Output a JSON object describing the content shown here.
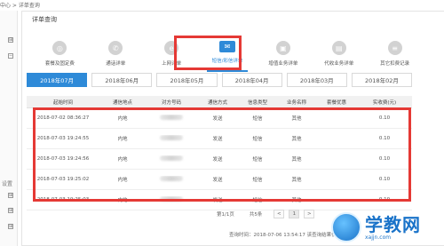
{
  "breadcrumb": "中心 > 详单查询",
  "left_nav": {
    "section_label": "设置",
    "expand_glyph": "⊞"
  },
  "panel_title": "详单查询",
  "services": [
    {
      "label": "套餐及固定费",
      "icon": "circle-icon",
      "glyph": "◎"
    },
    {
      "label": "通话详单",
      "icon": "phone-icon",
      "glyph": "✆"
    },
    {
      "label": "上网详单",
      "icon": "globe-icon",
      "glyph": "e"
    },
    {
      "label": "短信/彩信详单",
      "icon": "envelope-icon",
      "glyph": "✉",
      "active": true
    },
    {
      "label": "增值业务详单",
      "icon": "bag-icon",
      "glyph": "▣"
    },
    {
      "label": "代收业务详单",
      "icon": "card-icon",
      "glyph": "▤"
    },
    {
      "label": "其它扣费记录",
      "icon": "receipt-icon",
      "glyph": "≡"
    }
  ],
  "months": [
    "2018年07月",
    "2018年06月",
    "2018年05月",
    "2018年04月",
    "2018年03月",
    "2018年02月"
  ],
  "active_month_index": 0,
  "table": {
    "headers": [
      "起始时间",
      "通信地点",
      "对方号码",
      "通信方式",
      "信息类型",
      "业务名称",
      "套餐优惠",
      "实收费(元)"
    ],
    "rows": [
      [
        "2018-07-02 08:36:27",
        "内地",
        "",
        "发送",
        "短信",
        "其他",
        "",
        "0.10"
      ],
      [
        "2018-07-03 19:24:55",
        "内地",
        "",
        "发送",
        "短信",
        "其他",
        "",
        "0.10"
      ],
      [
        "2018-07-03 19:24:56",
        "内地",
        "",
        "发送",
        "短信",
        "其他",
        "",
        "0.10"
      ],
      [
        "2018-07-03 19:25:02",
        "内地",
        "",
        "发送",
        "短信",
        "其他",
        "",
        "0.10"
      ],
      [
        "2018-07-03 19:25:03",
        "内地",
        "",
        "发送",
        "短信",
        "其他",
        "",
        "0.10"
      ]
    ]
  },
  "pager": {
    "page_info": "第1/1页",
    "count": "共5条",
    "prev": "<",
    "page": "1",
    "next": ">"
  },
  "query_time": "查询时间：2018-07-06 13:54:17 该查询结果仅供参考。",
  "watermark": {
    "title": "学教网",
    "url": "xajjn.com"
  },
  "colors": {
    "accent": "#2e8ad8",
    "highlight": "#e53935"
  }
}
